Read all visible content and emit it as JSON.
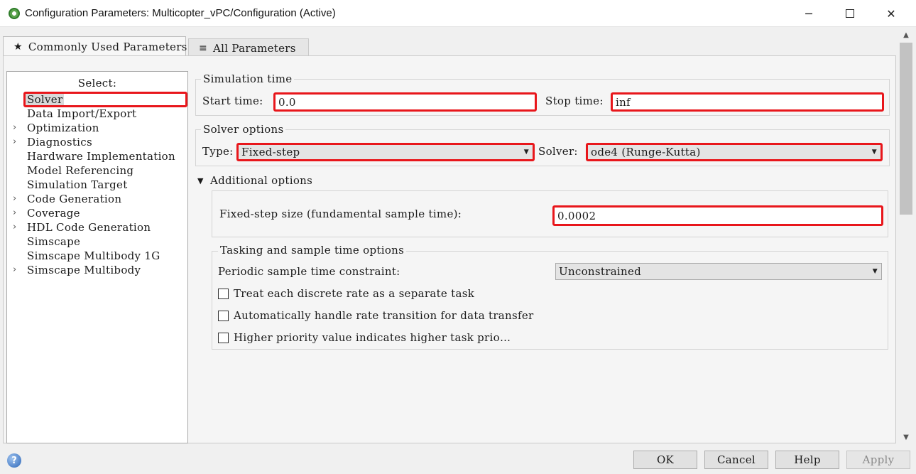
{
  "window": {
    "title": "Configuration Parameters: Multicopter_vPC/Configuration (Active)",
    "minimize_glyph": "─",
    "close_glyph": "✕"
  },
  "tabs": [
    {
      "label": "Commonly Used Parameters",
      "icon": "★",
      "selected": true
    },
    {
      "label": "All Parameters",
      "icon": "≡",
      "selected": false
    }
  ],
  "tree": {
    "select_label": "Select:",
    "items": [
      {
        "label": "Solver",
        "expandable": false,
        "selected": true
      },
      {
        "label": "Data Import/Export",
        "expandable": false
      },
      {
        "label": "Optimization",
        "expandable": true
      },
      {
        "label": "Diagnostics",
        "expandable": true
      },
      {
        "label": "Hardware Implementation",
        "expandable": false
      },
      {
        "label": "Model Referencing",
        "expandable": false
      },
      {
        "label": "Simulation Target",
        "expandable": false
      },
      {
        "label": "Code Generation",
        "expandable": true
      },
      {
        "label": "Coverage",
        "expandable": true
      },
      {
        "label": "HDL Code Generation",
        "expandable": true
      },
      {
        "label": "Simscape",
        "expandable": false
      },
      {
        "label": "Simscape Multibody 1G",
        "expandable": false
      },
      {
        "label": "Simscape Multibody",
        "expandable": true
      }
    ],
    "expand_glyph": "›"
  },
  "simulation_time": {
    "title": "Simulation time",
    "start_label": "Start time:",
    "start_value": "0.0",
    "stop_label": "Stop time:",
    "stop_value": "inf"
  },
  "solver_options": {
    "title": "Solver options",
    "type_label": "Type:",
    "type_value": "Fixed-step",
    "solver_label": "Solver:",
    "solver_value": "ode4 (Runge-Kutta)"
  },
  "additional_options": {
    "toggle_glyph": "▼",
    "title": "Additional options",
    "fixed_step_label": "Fixed-step size (fundamental sample time):",
    "fixed_step_value": "0.0002"
  },
  "tasking": {
    "title": "Tasking and sample time options",
    "periodic_label": "Periodic sample time constraint:",
    "periodic_value": "Unconstrained",
    "checkboxes": [
      {
        "label": "Treat each discrete rate as a separate task",
        "checked": false
      },
      {
        "label": "Automatically handle rate transition for data transfer",
        "checked": false
      },
      {
        "label": "Higher priority value indicates higher task prio…",
        "checked": false
      }
    ]
  },
  "caret_glyph": "▼",
  "scroll": {
    "up_glyph": "▲",
    "down_glyph": "▼"
  },
  "buttons": {
    "help_icon": "?",
    "ok": "OK",
    "cancel": "Cancel",
    "help": "Help",
    "apply": "Apply"
  },
  "colors": {
    "highlight": "#e8161b"
  }
}
